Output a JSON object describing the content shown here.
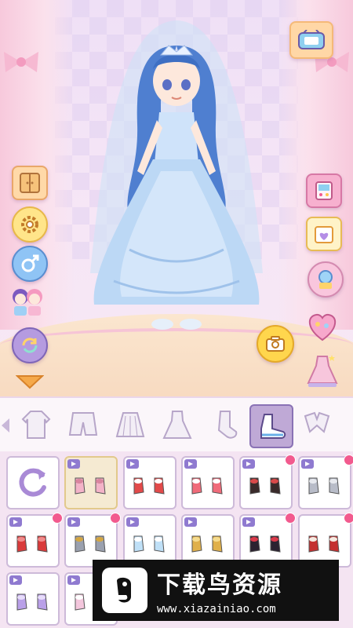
{
  "banner": {
    "title": "下载鸟资源",
    "url": "www.xiazainiao.com"
  },
  "left_toolbar": [
    "wardrobe-icon",
    "settings-icon",
    "gender-icon",
    "characters-icon",
    "refresh-icon",
    "expand-arrow-icon"
  ],
  "right_toolbar": [
    "game-machine-icon",
    "calendar-heart-icon",
    "gacha-icon",
    "heart-box-icon",
    "dress-preview-icon"
  ],
  "categories": [
    {
      "name": "coat",
      "active": false
    },
    {
      "name": "shorts",
      "active": false
    },
    {
      "name": "skirt",
      "active": false
    },
    {
      "name": "dress",
      "active": false
    },
    {
      "name": "socks",
      "active": false
    },
    {
      "name": "shoes",
      "active": true
    },
    {
      "name": "accessories",
      "active": false
    }
  ],
  "items": [
    {
      "kind": "reset",
      "video": false,
      "new": false,
      "selected": false
    },
    {
      "kind": "pink-sandals",
      "video": true,
      "new": false,
      "selected": true
    },
    {
      "kind": "red-white-shoes",
      "video": true,
      "new": false,
      "selected": false
    },
    {
      "kind": "red-sneakers",
      "video": true,
      "new": false,
      "selected": false
    },
    {
      "kind": "black-red-shoes",
      "video": true,
      "new": true,
      "selected": false
    },
    {
      "kind": "grey-boots",
      "video": true,
      "new": true,
      "selected": false
    },
    {
      "kind": "red-bow-shoes",
      "video": true,
      "new": true,
      "selected": false
    },
    {
      "kind": "silver-heels",
      "video": true,
      "new": true,
      "selected": false
    },
    {
      "kind": "blue-slippers",
      "video": true,
      "new": false,
      "selected": false
    },
    {
      "kind": "gold-sandals",
      "video": true,
      "new": false,
      "selected": false
    },
    {
      "kind": "black-pumps",
      "video": true,
      "new": true,
      "selected": false
    },
    {
      "kind": "red-boots",
      "video": false,
      "new": true,
      "selected": false
    },
    {
      "kind": "purple-bow-shoes",
      "video": true,
      "new": false,
      "selected": false
    },
    {
      "kind": "pink-boots",
      "video": true,
      "new": false,
      "selected": false
    }
  ],
  "colors": {
    "accent": "#8a72b5",
    "new_badge": "#f25a8e",
    "stage_bg": "#efe0f6"
  }
}
